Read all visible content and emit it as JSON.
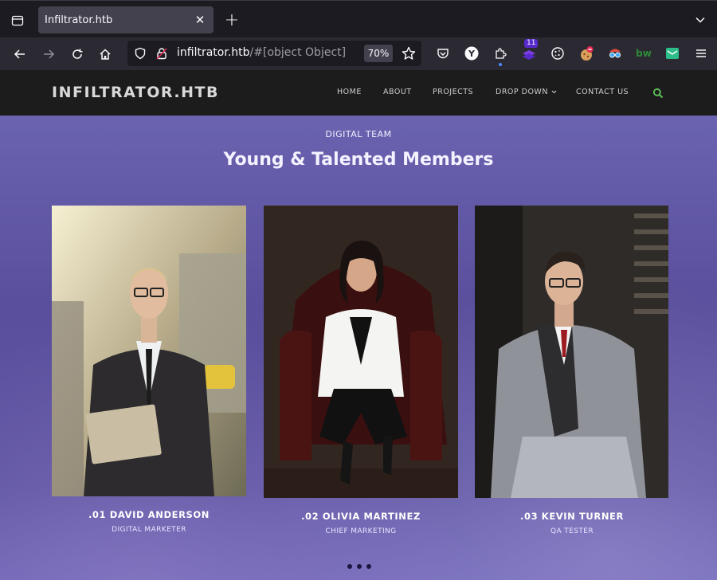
{
  "browser": {
    "tab_title": "Infiltrator.htb",
    "url_host": "infiltrator.htb",
    "url_path": "/#[object Object]",
    "zoom": "70%",
    "extension_badge": "11"
  },
  "site": {
    "logo": "INFILTRATOR.HTB",
    "menu": [
      "HOME",
      "ABOUT",
      "PROJECTS",
      "DROP DOWN",
      "CONTACT US"
    ],
    "accent_color": "#5fc35a"
  },
  "team": {
    "subtitle": "DIGITAL TEAM",
    "heading": "Young & Talented Members",
    "members": [
      {
        "name": ".01 DAVID ANDERSON",
        "role": "DIGITAL MARKETER"
      },
      {
        "name": ".02 OLIVIA MARTINEZ",
        "role": "CHIEF MARKETING"
      },
      {
        "name": ".03 KEVIN TURNER",
        "role": "QA TESTER"
      }
    ]
  },
  "carousel": {
    "dots": 3
  }
}
